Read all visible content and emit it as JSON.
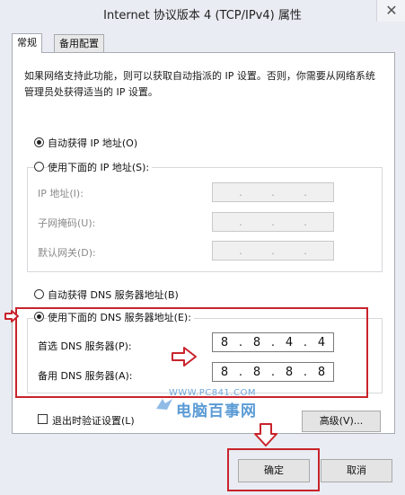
{
  "window": {
    "title": "Internet 协议版本 4 (TCP/IPv4) 属性",
    "close_glyph": "✕"
  },
  "tabs": [
    {
      "label": "常规",
      "active": true
    },
    {
      "label": "备用配置",
      "active": false
    }
  ],
  "description": "如果网络支持此功能，则可以获取自动指派的 IP 设置。否则，你需要从网络系统管理员处获得适当的 IP 设置。",
  "ip_section": {
    "auto_label": "自动获得 IP 地址(O)",
    "auto_selected": true,
    "manual_label": "使用下面的 IP 地址(S):",
    "manual_selected": false,
    "fields": [
      {
        "label": "IP 地址(I):",
        "value": ". . ."
      },
      {
        "label": "子网掩码(U):",
        "value": ". . ."
      },
      {
        "label": "默认网关(D):",
        "value": ". . ."
      }
    ]
  },
  "dns_section": {
    "auto_label": "自动获得 DNS 服务器地址(B)",
    "auto_selected": false,
    "manual_label": "使用下面的 DNS 服务器地址(E):",
    "manual_selected": true,
    "preferred": {
      "label": "首选 DNS 服务器(P):",
      "octets": [
        "8",
        "8",
        "4",
        "4"
      ]
    },
    "alternate": {
      "label": "备用 DNS 服务器(A):",
      "octets": [
        "8",
        "8",
        "8",
        "8"
      ]
    }
  },
  "validate": {
    "label": "退出时验证设置(L)",
    "checked": false
  },
  "buttons": {
    "advanced": "高级(V)...",
    "ok": "确定",
    "cancel": "取消"
  },
  "watermark": {
    "url": "WWW.PC841.COM",
    "text": "电脑百事网"
  },
  "colors": {
    "annotation_red": "#c8232c",
    "watermark_blue": "#5b9bd5"
  }
}
